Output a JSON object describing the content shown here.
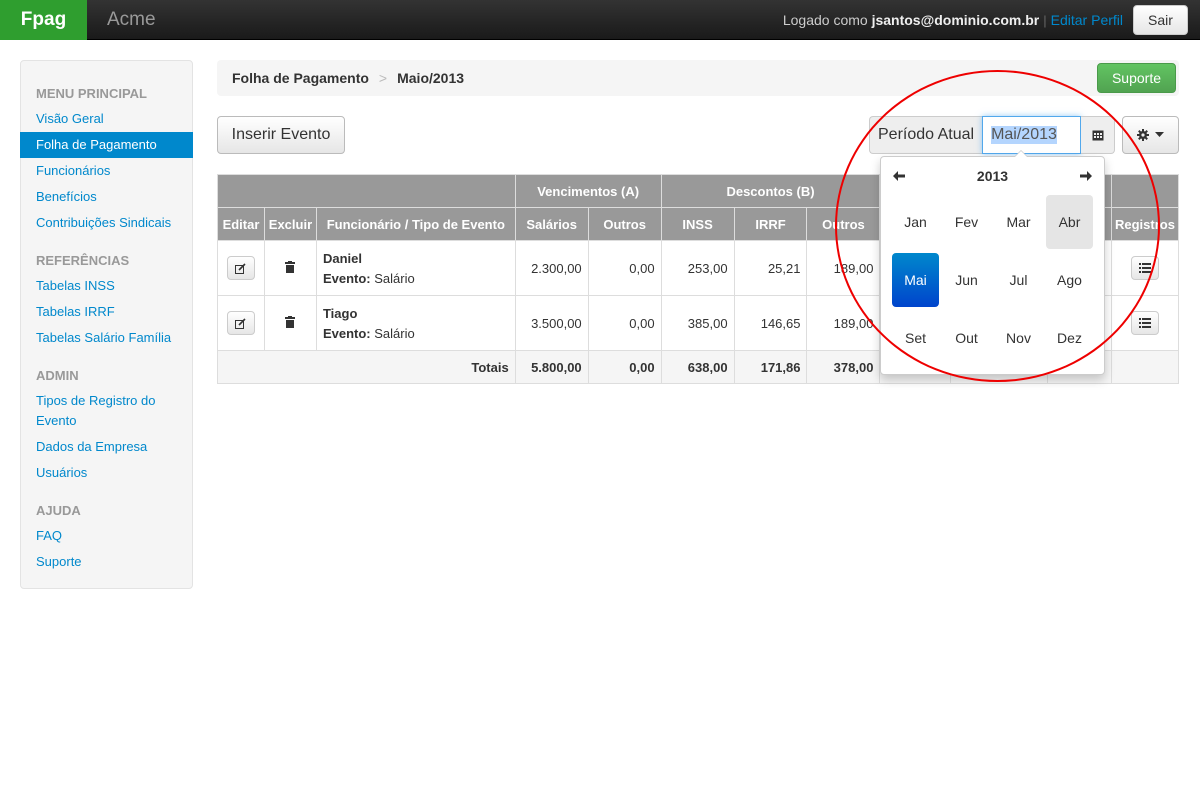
{
  "navbar": {
    "brand": "Fpag",
    "company": "Acme",
    "logged_prefix": "Logado como",
    "user": "jsantos@dominio.com.br",
    "separator": "|",
    "edit_profile": "Editar Perfil",
    "logout": "Sair"
  },
  "sidebar": {
    "sections": [
      {
        "header": "MENU PRINCIPAL",
        "items": [
          "Visão Geral",
          "Folha de Pagamento",
          "Funcionários",
          "Benefícios",
          "Contribuições Sindicais"
        ]
      },
      {
        "header": "REFERÊNCIAS",
        "items": [
          "Tabelas INSS",
          "Tabelas IRRF",
          "Tabelas Salário Família"
        ]
      },
      {
        "header": "ADMIN",
        "items": [
          "Tipos de Registro do Evento",
          "Dados da Empresa",
          "Usuários"
        ]
      },
      {
        "header": "AJUDA",
        "items": [
          "FAQ",
          "Suporte"
        ]
      }
    ],
    "active_item": "Folha de Pagamento"
  },
  "breadcrumb": {
    "items": [
      "Folha de Pagamento",
      "Maio/2013"
    ],
    "divider": ">"
  },
  "support_button": "Suporte",
  "toolbar": {
    "insert_event": "Inserir Evento",
    "period_label": "Período Atual",
    "period_value": "Mai/2013",
    "calendar_icon": "calendar-icon",
    "settings_icon": "gear-icon"
  },
  "table": {
    "group_headers": {
      "vencimentos": "Vencimentos (A)",
      "descontos": "Descontos (B)"
    },
    "columns": [
      "Editar",
      "Excluir",
      "Funcionário / Tipo de Evento",
      "Salários",
      "Outros",
      "INSS",
      "IRRF",
      "Outros",
      "Registros"
    ],
    "rows": [
      {
        "name": "Daniel",
        "event_label": "Evento:",
        "event": "Salário",
        "salarios": "2.300,00",
        "outros_a": "0,00",
        "inss": "253,00",
        "irrf": "25,21",
        "outros_b": "189,00"
      },
      {
        "name": "Tiago",
        "event_label": "Evento:",
        "event": "Salário",
        "salarios": "3.500,00",
        "outros_a": "0,00",
        "inss": "385,00",
        "irrf": "146,65",
        "outros_b": "189,00"
      }
    ],
    "totals": {
      "label": "Totais",
      "salarios": "5.800,00",
      "outros_a": "0,00",
      "inss": "638,00",
      "irrf": "171,86",
      "outros_b": "378,00"
    }
  },
  "datepicker": {
    "year": "2013",
    "months": [
      "Jan",
      "Fev",
      "Mar",
      "Abr",
      "Mai",
      "Jun",
      "Jul",
      "Ago",
      "Set",
      "Out",
      "Nov",
      "Dez"
    ],
    "selected": "Mai",
    "hovered": "Abr"
  },
  "colors": {
    "brand": "#2f9e2f",
    "accent": "#0088cc",
    "annotation": "#ee0000"
  }
}
